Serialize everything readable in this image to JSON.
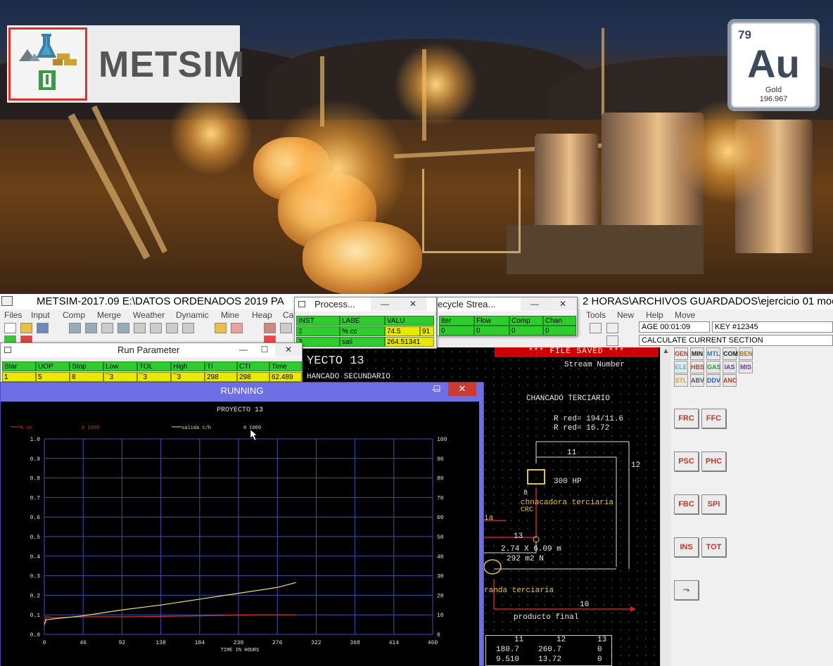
{
  "banner": {
    "logo_text": "METSIM",
    "element": {
      "number": "79",
      "symbol": "Au",
      "name": "Gold",
      "mass": "196.967"
    }
  },
  "app": {
    "title": "METSIM-2017.09    E:\\DATOS ORDENADOS 2019 PA",
    "title_tail": "2 HORAS\\ARCHIVOS GUARDADOS\\ejercicio 01 mod",
    "menus": [
      "Files",
      "Input",
      "Comp",
      "Merge",
      "Weather",
      "Dynamic",
      "Mine",
      "Heap",
      "Ca"
    ],
    "menus_right": [
      "Tools",
      "New",
      "Help",
      "Move"
    ],
    "age_field": "AGE 00:01:09",
    "key_field": "KEY #12345",
    "calc_field": "CALCULATE CURRENT SECTION"
  },
  "process_window": {
    "title": "Process...",
    "headers": [
      "INST",
      "LABE",
      "VALU"
    ],
    "rows": [
      {
        "inst": "2",
        "label": "% cc",
        "value": "74.5",
        "extra": "91"
      },
      {
        "inst": "3",
        "label": "sali",
        "value": "264.51341"
      }
    ]
  },
  "recycle_window": {
    "title": "ecycle Strea...",
    "headers": [
      "Iter",
      "Flow",
      "Comp",
      "Chan"
    ],
    "values": [
      "0",
      "0",
      "0",
      "0"
    ]
  },
  "run_parameter": {
    "title": "Run Parameter",
    "headers": [
      "Star",
      "UOP",
      "Stop",
      "Low",
      "TOL",
      "High",
      "TI",
      "CTI",
      "Time"
    ],
    "values": [
      "1",
      "5",
      "8",
      "¯3",
      "¯3",
      "¯3",
      "298",
      "298",
      "62.489"
    ]
  },
  "running": {
    "title": "RUNNING",
    "plot_title": "PROYECTO 13",
    "legend": [
      {
        "label": "% cc",
        "range": "0 1000",
        "color": "#e03030"
      },
      {
        "label": "salida t/h",
        "range": "0 1000",
        "color": "#e8e070"
      }
    ],
    "xlabel": "TIME IN HOURS",
    "xticks": [
      "0",
      "46",
      "92",
      "138",
      "184",
      "230",
      "276",
      "322",
      "368",
      "414",
      "460"
    ],
    "yticks_left": [
      "1.0",
      "0.9",
      "0.8",
      "0.7",
      "0.6",
      "0.5",
      "0.4",
      "0.3",
      "0.2",
      "0.1",
      "0.0"
    ],
    "yticks_right": [
      "100",
      "90",
      "80",
      "70",
      "60",
      "50",
      "40",
      "30",
      "20",
      "10",
      "0"
    ]
  },
  "chart_data": {
    "type": "line",
    "title": "PROYECTO 13",
    "xlabel": "TIME IN HOURS",
    "xlim": [
      0,
      460
    ],
    "ylim_left": [
      0,
      1.0
    ],
    "ylim_right": [
      0,
      100
    ],
    "series": [
      {
        "name": "% cc",
        "axis": "left",
        "x": [
          0,
          2,
          10,
          46,
          100,
          184,
          250,
          298
        ],
        "y": [
          0.04,
          0.09,
          0.085,
          0.09,
          0.09,
          0.095,
          0.1,
          0.1
        ]
      },
      {
        "name": "salida t/h",
        "axis": "left",
        "x": [
          0,
          2,
          46,
          92,
          138,
          184,
          230,
          276,
          298
        ],
        "y": [
          0.05,
          0.075,
          0.095,
          0.125,
          0.15,
          0.18,
          0.21,
          0.24,
          0.265
        ]
      }
    ]
  },
  "schematic": {
    "file_saved": "*** FILE SAVED ***",
    "project": "YECTO 13",
    "section": "HANCADO SECUNDARIO",
    "stream_number": "Stream Number",
    "chancado": "CHANCADO TERCIARIO",
    "rred1": "R red= 194/11.6",
    "rred2": "R red= 16.72",
    "n11": "11",
    "n12": "12",
    "hp": "300 HP",
    "n8": "8",
    "crusher": "chnacadora terciaria",
    "crc": "CRC",
    "ia": "ia",
    "n13": "13",
    "dims": "2.74 X 6.09 m",
    "area": "292 m2 N",
    "zaranda": "randa terciaria",
    "n10": "10",
    "product": "producto final",
    "table": {
      "headers": [
        "11",
        "12",
        "13"
      ],
      "row1": [
        "180.7",
        "260.7",
        "0"
      ],
      "row2": [
        "9.510",
        "13.72",
        "0"
      ]
    }
  },
  "right_panel": {
    "small_buttons": [
      "GEN",
      "MIN",
      "MTL",
      "COM",
      "BEN",
      "ELE",
      "HBS",
      "GAS",
      "IAS",
      "MIS",
      "STL",
      "ABV",
      "DDV",
      "ANC"
    ],
    "big_buttons": [
      "FRC",
      "FFC",
      "PSC",
      "PHC",
      "FBC",
      "SPI",
      "INS",
      "TOT"
    ]
  }
}
